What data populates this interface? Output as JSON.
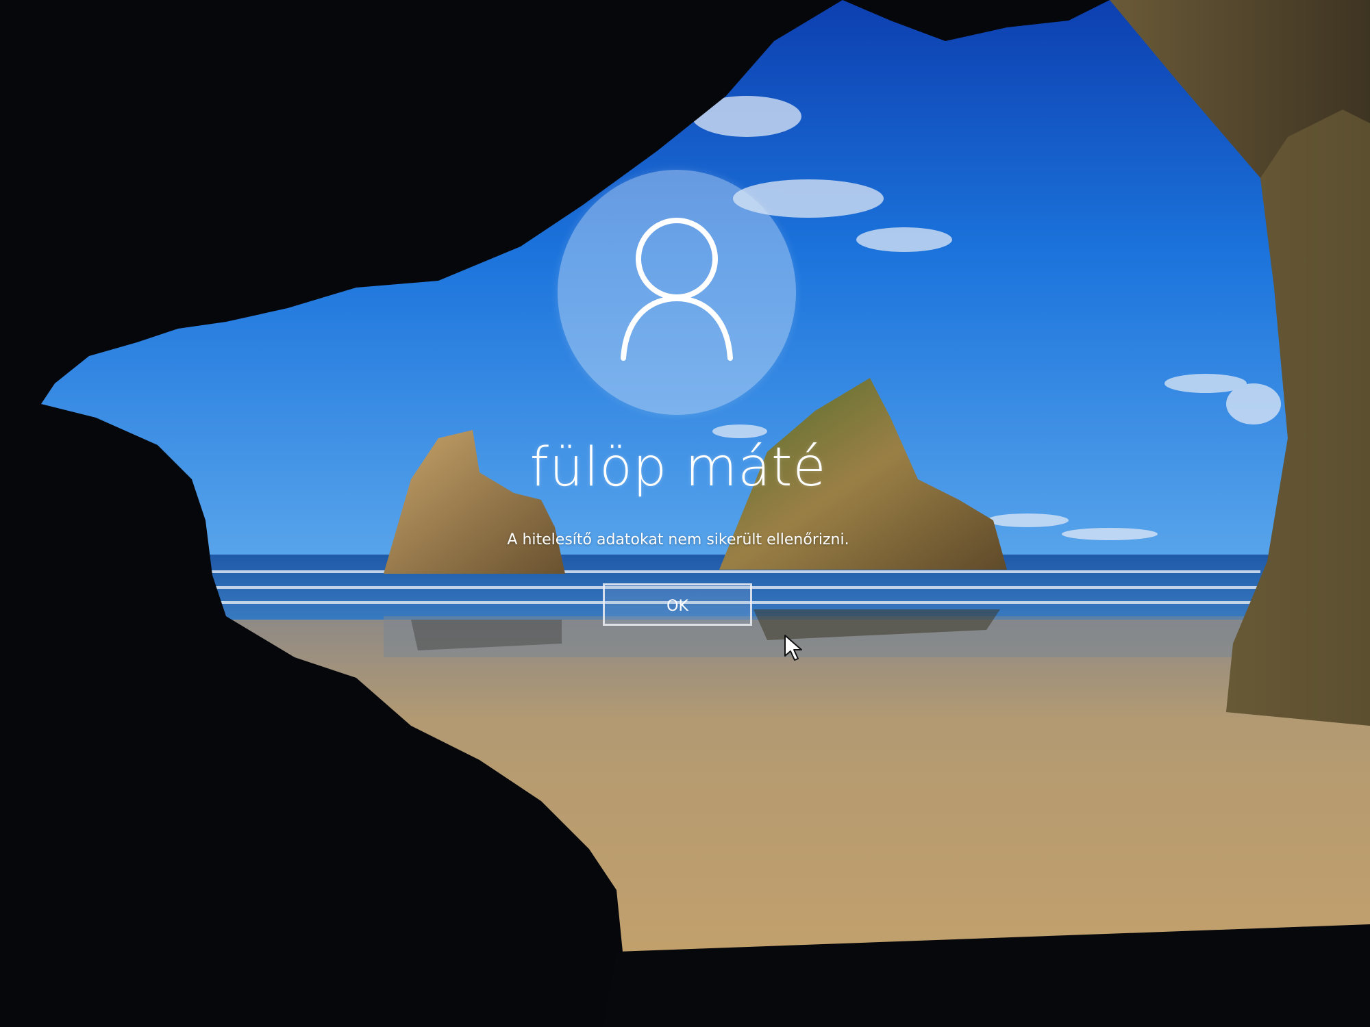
{
  "lock_screen": {
    "user_name": "fülöp máté",
    "error_message": "A hitelesítő adatokat nem sikerült ellenőrizni.",
    "ok_button_label": "OK"
  },
  "icons": {
    "avatar": "user-avatar-icon",
    "cursor": "mouse-pointer-icon"
  },
  "colors": {
    "sky": "#1d6fd6",
    "sea": "#2a6cb5",
    "sand": "#b79a6a",
    "cave": "#07080d",
    "text": "#ffffff"
  }
}
